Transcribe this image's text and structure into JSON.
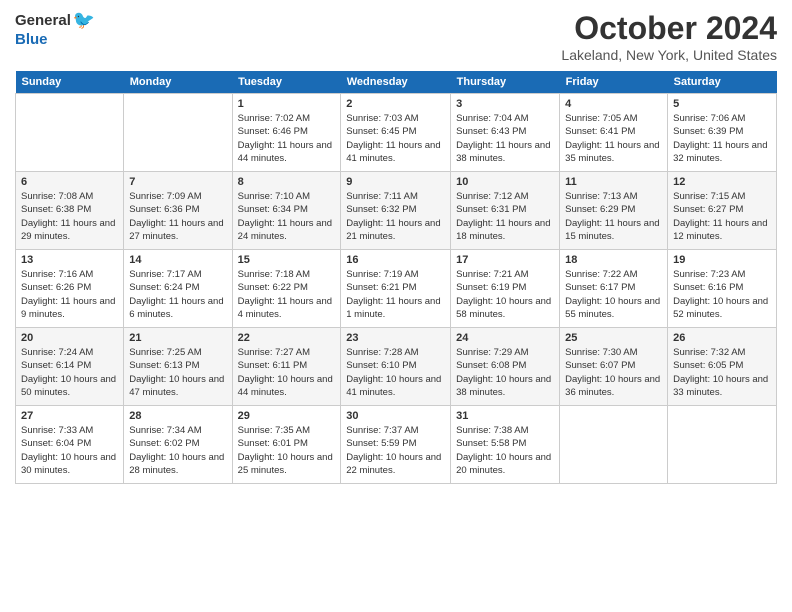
{
  "header": {
    "logo_general": "General",
    "logo_blue": "Blue",
    "title": "October 2024",
    "location": "Lakeland, New York, United States"
  },
  "days_of_week": [
    "Sunday",
    "Monday",
    "Tuesday",
    "Wednesday",
    "Thursday",
    "Friday",
    "Saturday"
  ],
  "weeks": [
    [
      {
        "day": "",
        "sunrise": "",
        "sunset": "",
        "daylight": ""
      },
      {
        "day": "",
        "sunrise": "",
        "sunset": "",
        "daylight": ""
      },
      {
        "day": "1",
        "sunrise": "Sunrise: 7:02 AM",
        "sunset": "Sunset: 6:46 PM",
        "daylight": "Daylight: 11 hours and 44 minutes."
      },
      {
        "day": "2",
        "sunrise": "Sunrise: 7:03 AM",
        "sunset": "Sunset: 6:45 PM",
        "daylight": "Daylight: 11 hours and 41 minutes."
      },
      {
        "day": "3",
        "sunrise": "Sunrise: 7:04 AM",
        "sunset": "Sunset: 6:43 PM",
        "daylight": "Daylight: 11 hours and 38 minutes."
      },
      {
        "day": "4",
        "sunrise": "Sunrise: 7:05 AM",
        "sunset": "Sunset: 6:41 PM",
        "daylight": "Daylight: 11 hours and 35 minutes."
      },
      {
        "day": "5",
        "sunrise": "Sunrise: 7:06 AM",
        "sunset": "Sunset: 6:39 PM",
        "daylight": "Daylight: 11 hours and 32 minutes."
      }
    ],
    [
      {
        "day": "6",
        "sunrise": "Sunrise: 7:08 AM",
        "sunset": "Sunset: 6:38 PM",
        "daylight": "Daylight: 11 hours and 29 minutes."
      },
      {
        "day": "7",
        "sunrise": "Sunrise: 7:09 AM",
        "sunset": "Sunset: 6:36 PM",
        "daylight": "Daylight: 11 hours and 27 minutes."
      },
      {
        "day": "8",
        "sunrise": "Sunrise: 7:10 AM",
        "sunset": "Sunset: 6:34 PM",
        "daylight": "Daylight: 11 hours and 24 minutes."
      },
      {
        "day": "9",
        "sunrise": "Sunrise: 7:11 AM",
        "sunset": "Sunset: 6:32 PM",
        "daylight": "Daylight: 11 hours and 21 minutes."
      },
      {
        "day": "10",
        "sunrise": "Sunrise: 7:12 AM",
        "sunset": "Sunset: 6:31 PM",
        "daylight": "Daylight: 11 hours and 18 minutes."
      },
      {
        "day": "11",
        "sunrise": "Sunrise: 7:13 AM",
        "sunset": "Sunset: 6:29 PM",
        "daylight": "Daylight: 11 hours and 15 minutes."
      },
      {
        "day": "12",
        "sunrise": "Sunrise: 7:15 AM",
        "sunset": "Sunset: 6:27 PM",
        "daylight": "Daylight: 11 hours and 12 minutes."
      }
    ],
    [
      {
        "day": "13",
        "sunrise": "Sunrise: 7:16 AM",
        "sunset": "Sunset: 6:26 PM",
        "daylight": "Daylight: 11 hours and 9 minutes."
      },
      {
        "day": "14",
        "sunrise": "Sunrise: 7:17 AM",
        "sunset": "Sunset: 6:24 PM",
        "daylight": "Daylight: 11 hours and 6 minutes."
      },
      {
        "day": "15",
        "sunrise": "Sunrise: 7:18 AM",
        "sunset": "Sunset: 6:22 PM",
        "daylight": "Daylight: 11 hours and 4 minutes."
      },
      {
        "day": "16",
        "sunrise": "Sunrise: 7:19 AM",
        "sunset": "Sunset: 6:21 PM",
        "daylight": "Daylight: 11 hours and 1 minute."
      },
      {
        "day": "17",
        "sunrise": "Sunrise: 7:21 AM",
        "sunset": "Sunset: 6:19 PM",
        "daylight": "Daylight: 10 hours and 58 minutes."
      },
      {
        "day": "18",
        "sunrise": "Sunrise: 7:22 AM",
        "sunset": "Sunset: 6:17 PM",
        "daylight": "Daylight: 10 hours and 55 minutes."
      },
      {
        "day": "19",
        "sunrise": "Sunrise: 7:23 AM",
        "sunset": "Sunset: 6:16 PM",
        "daylight": "Daylight: 10 hours and 52 minutes."
      }
    ],
    [
      {
        "day": "20",
        "sunrise": "Sunrise: 7:24 AM",
        "sunset": "Sunset: 6:14 PM",
        "daylight": "Daylight: 10 hours and 50 minutes."
      },
      {
        "day": "21",
        "sunrise": "Sunrise: 7:25 AM",
        "sunset": "Sunset: 6:13 PM",
        "daylight": "Daylight: 10 hours and 47 minutes."
      },
      {
        "day": "22",
        "sunrise": "Sunrise: 7:27 AM",
        "sunset": "Sunset: 6:11 PM",
        "daylight": "Daylight: 10 hours and 44 minutes."
      },
      {
        "day": "23",
        "sunrise": "Sunrise: 7:28 AM",
        "sunset": "Sunset: 6:10 PM",
        "daylight": "Daylight: 10 hours and 41 minutes."
      },
      {
        "day": "24",
        "sunrise": "Sunrise: 7:29 AM",
        "sunset": "Sunset: 6:08 PM",
        "daylight": "Daylight: 10 hours and 38 minutes."
      },
      {
        "day": "25",
        "sunrise": "Sunrise: 7:30 AM",
        "sunset": "Sunset: 6:07 PM",
        "daylight": "Daylight: 10 hours and 36 minutes."
      },
      {
        "day": "26",
        "sunrise": "Sunrise: 7:32 AM",
        "sunset": "Sunset: 6:05 PM",
        "daylight": "Daylight: 10 hours and 33 minutes."
      }
    ],
    [
      {
        "day": "27",
        "sunrise": "Sunrise: 7:33 AM",
        "sunset": "Sunset: 6:04 PM",
        "daylight": "Daylight: 10 hours and 30 minutes."
      },
      {
        "day": "28",
        "sunrise": "Sunrise: 7:34 AM",
        "sunset": "Sunset: 6:02 PM",
        "daylight": "Daylight: 10 hours and 28 minutes."
      },
      {
        "day": "29",
        "sunrise": "Sunrise: 7:35 AM",
        "sunset": "Sunset: 6:01 PM",
        "daylight": "Daylight: 10 hours and 25 minutes."
      },
      {
        "day": "30",
        "sunrise": "Sunrise: 7:37 AM",
        "sunset": "Sunset: 5:59 PM",
        "daylight": "Daylight: 10 hours and 22 minutes."
      },
      {
        "day": "31",
        "sunrise": "Sunrise: 7:38 AM",
        "sunset": "Sunset: 5:58 PM",
        "daylight": "Daylight: 10 hours and 20 minutes."
      },
      {
        "day": "",
        "sunrise": "",
        "sunset": "",
        "daylight": ""
      },
      {
        "day": "",
        "sunrise": "",
        "sunset": "",
        "daylight": ""
      }
    ]
  ]
}
